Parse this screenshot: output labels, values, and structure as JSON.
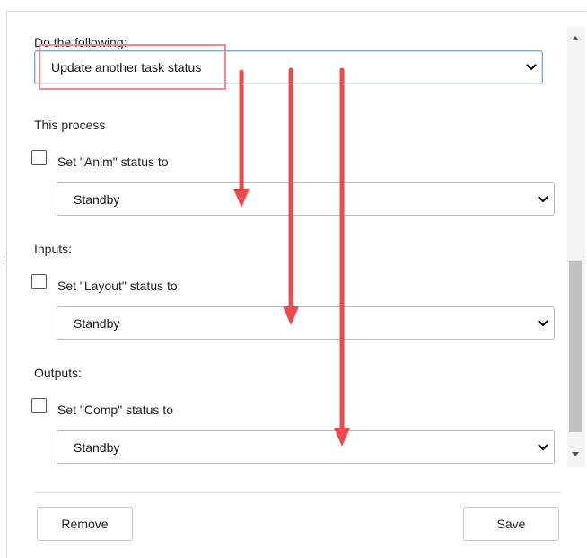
{
  "form": {
    "action_label": "Do the following:",
    "action_value": "Update another task status",
    "this_process_label": "This process",
    "inputs_label": "Inputs:",
    "outputs_label": "Outputs:"
  },
  "rules": [
    {
      "checkbox_label": "Set \"Anim\" status to",
      "status": "Standby",
      "checked": false
    },
    {
      "checkbox_label": "Set \"Layout\" status to",
      "status": "Standby",
      "checked": false
    },
    {
      "checkbox_label": "Set \"Comp\" status to",
      "status": "Standby",
      "checked": false
    }
  ],
  "footer": {
    "remove_label": "Remove",
    "save_label": "Save"
  },
  "annotation": {
    "color": "#f0494d",
    "highlight_color": "#f08c8c"
  },
  "icons": {
    "dropdown": "chevron-down-icon",
    "scroll_up": "scroll-up-arrow-icon",
    "scroll_down": "scroll-down-arrow-icon",
    "annotation_arrow": "arrow-down-icon"
  }
}
